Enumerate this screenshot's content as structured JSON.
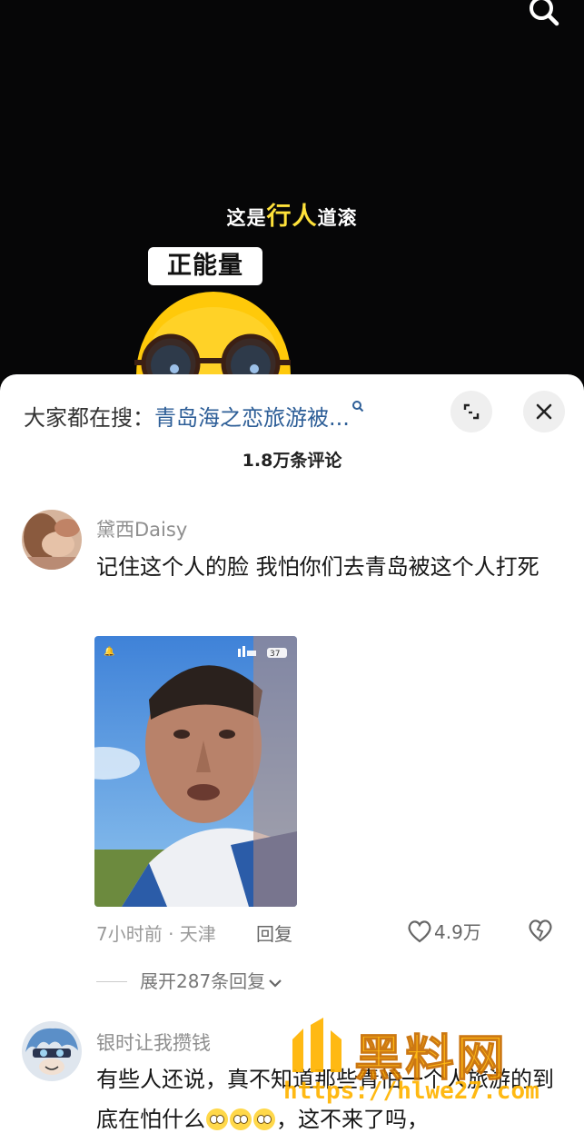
{
  "video": {
    "caption_pre": "这是",
    "caption_highlight": "行人",
    "caption_post": "道滚",
    "badge": "正能量",
    "search_icon": "search-icon"
  },
  "sheet": {
    "hot_search_label": "大家都在搜：",
    "hot_search_term": "青岛海之恋旅游被...",
    "expand_icon": "expand-icon",
    "close_icon": "close-icon",
    "comment_count": "1.8万条评论"
  },
  "comments": [
    {
      "username": "黛西Daisy",
      "text": "记住这个人的脸  我怕你们去青岛被这个人打死",
      "image_battery": "37",
      "meta": "7小时前 · 天津",
      "reply_label": "回复",
      "likes": "4.9万",
      "expand_label": "展开287条回复"
    },
    {
      "username": "银时让我攒钱",
      "text_part1": "有些人还说，真不知道那些青怕一个人旅游的到底在怕什么",
      "text_part2": "，这不来了吗，"
    }
  ],
  "watermark": {
    "title": "黑料网",
    "url": "https://hlwe27.com"
  },
  "colors": {
    "highlight": "#ffe23a",
    "link": "#2d5e97",
    "watermark": "#ffb400"
  }
}
